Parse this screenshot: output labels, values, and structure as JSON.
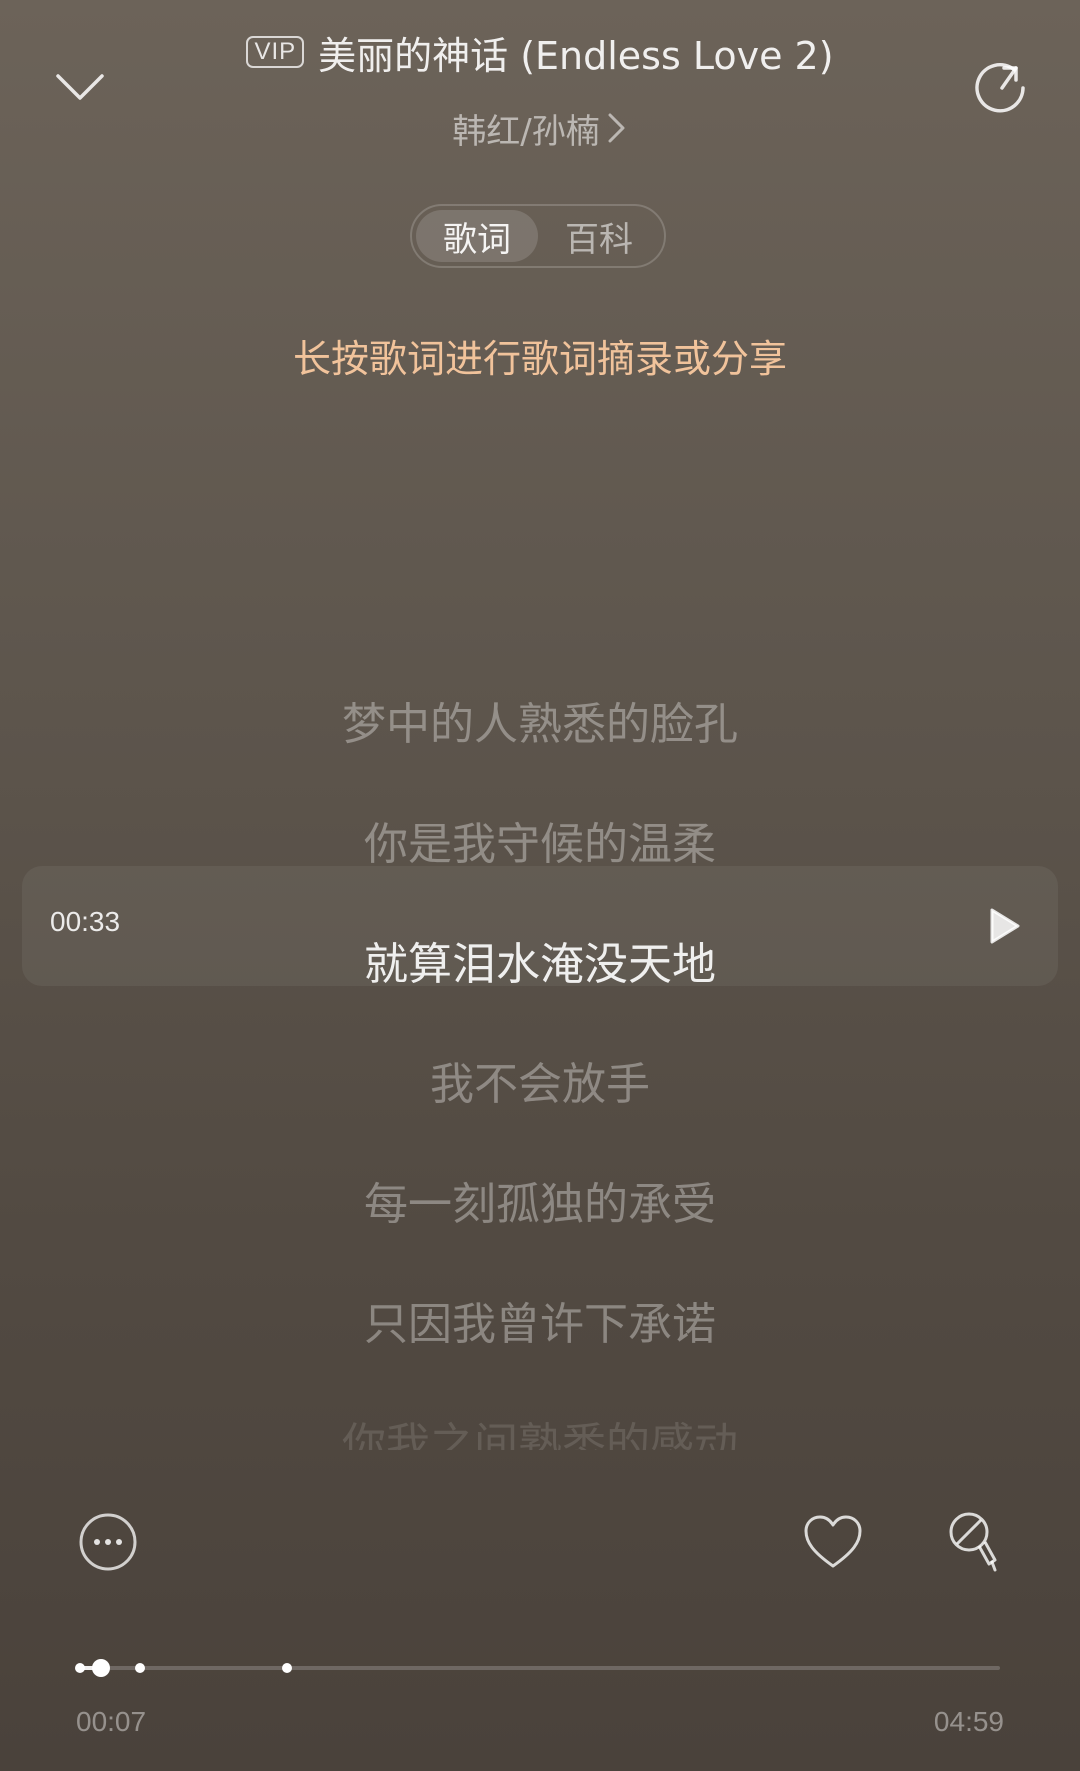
{
  "header": {
    "vip_badge": "VIP",
    "song_title": "美丽的神话 (Endless Love 2)",
    "artist": "韩红/孙楠",
    "back_icon": "chevron-down-icon",
    "share_icon": "share-icon"
  },
  "tabs": [
    {
      "label": "歌词",
      "active": true
    },
    {
      "label": "百科",
      "active": false
    }
  ],
  "hint": "长按歌词进行歌词摘录或分享",
  "lyrics": [
    {
      "text": "梦中的人熟悉的脸孔",
      "state": "normal"
    },
    {
      "text": "你是我守候的温柔",
      "state": "normal"
    },
    {
      "text": "就算泪水淹没天地",
      "state": "current"
    },
    {
      "text": "我不会放手",
      "state": "normal"
    },
    {
      "text": "每一刻孤独的承受",
      "state": "normal"
    },
    {
      "text": "只因我曾许下承诺",
      "state": "normal"
    },
    {
      "text": "你我之间熟悉的感动",
      "state": "fading"
    }
  ],
  "seek": {
    "time": "00:33",
    "play_icon": "play-icon"
  },
  "actions": {
    "more_icon": "more-icon",
    "like_icon": "heart-icon",
    "sing_icon": "microphone-icon"
  },
  "progress": {
    "current": "00:07",
    "total": "04:59",
    "played_fraction": 0.023,
    "markers": [
      0.0,
      0.065,
      0.225
    ]
  },
  "colors": {
    "hint": "#f1c39b",
    "background_top": "#6c6359",
    "background_bottom": "#4a423b"
  }
}
